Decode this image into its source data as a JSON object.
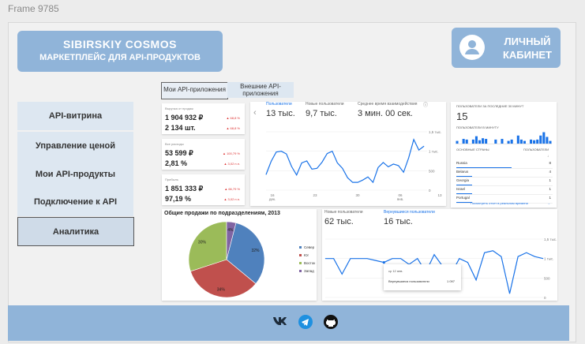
{
  "frame_label": "Frame 9785",
  "brand": {
    "title": "SIBIRSKIY COSMOS",
    "subtitle": "МАРКЕТПЛЕЙС ДЛЯ API-ПРОДУКТОВ"
  },
  "cabinet": {
    "label_line1": "ЛИЧНЫЙ",
    "label_line2": "КАБИНЕТ"
  },
  "sidebar": {
    "items": [
      {
        "label": "API-витрина"
      },
      {
        "label": "Управление ценой"
      },
      {
        "label": "Мои API-продукты"
      },
      {
        "label": "Подключение к API"
      },
      {
        "label": "Аналитика"
      }
    ]
  },
  "tabs": [
    {
      "label": "Мои API-приложения"
    },
    {
      "label": "Внешние API-приложения"
    }
  ],
  "kpi": [
    {
      "label": "Выручка от продаж",
      "v1": "1 904 932 ₽",
      "v2": "2 134 шт.",
      "d1": "▲ 68,8 %",
      "d2": "▲ 68,8 %"
    },
    {
      "label": "Все расходы",
      "v1": "53 599 ₽",
      "v2": "2,81 %",
      "d1": "▲ 100,79 %",
      "d2": "▲ 3,02 п.п."
    },
    {
      "label": "Прибыль",
      "v1": "1 851 333 ₽",
      "v2": "97,19 %",
      "d1": "▲ 66,79 %",
      "d2": "▲ 3,02 п.п."
    }
  ],
  "users_card": {
    "nav_prev": "‹",
    "metrics": [
      {
        "label": "Пользователи",
        "value": "13 тыс."
      },
      {
        "label": "Новые пользователи",
        "value": "9,7 тыс."
      },
      {
        "label": "Среднее время взаимодействия",
        "value": "3 мин. 00 сек."
      }
    ],
    "y_ticks": [
      "1,5 тыс.",
      "1 тыс.",
      "500",
      "0"
    ],
    "x_ticks": [
      "16 дек.",
      "23",
      "30",
      "06 янв.",
      "13"
    ]
  },
  "realtime": {
    "title": "ПОЛЬЗОВАТЕЛИ ЗА ПОСЛЕДНИЕ 30 МИНУТ",
    "value": "15",
    "per_minute": "ПОЛЬЗОВАТЕЛИ В МИНУТУ",
    "bars": [
      0.2,
      0,
      0.35,
      0.3,
      0,
      0.3,
      0.55,
      0.25,
      0.4,
      0.35,
      0,
      0,
      0.3,
      0,
      0.35,
      0,
      0.2,
      0.3,
      0,
      0.6,
      0.3,
      0.2,
      0,
      0.3,
      0.25,
      0.3,
      0.6,
      0.85,
      0.5,
      0.2
    ],
    "col_country": "ОСНОВНЫЕ СТРАНЫ",
    "col_users": "ПОЛЬЗОВАТЕЛИ",
    "countries": [
      {
        "name": "Russia",
        "value": "8"
      },
      {
        "name": "Belarus",
        "value": "4"
      },
      {
        "name": "Georgia",
        "value": "1"
      },
      {
        "name": "Israel",
        "value": "1"
      },
      {
        "name": "Portugal",
        "value": "1"
      }
    ],
    "link": "Посмотреть отчет в реальном времени"
  },
  "pie": {
    "title": "Общие продажи по подразделениям, 2013",
    "legend": [
      {
        "name": "Север",
        "color": "#4f81bd"
      },
      {
        "name": "Юг",
        "color": "#c0504d"
      },
      {
        "name": "Восток",
        "color": "#9bbb59"
      },
      {
        "name": "Запад",
        "color": "#8064a2"
      }
    ]
  },
  "chart_data": [
    {
      "type": "line",
      "title": "",
      "x_ticks": [
        "16 дек.",
        "23",
        "30",
        "06 янв.",
        "13"
      ],
      "ylim": [
        0,
        1500
      ],
      "series": [
        {
          "name": "",
          "values": [
            400,
            740,
            980,
            1000,
            930,
            610,
            390,
            700,
            750,
            540,
            560,
            720,
            940,
            1000,
            700,
            560,
            320,
            200,
            200,
            260,
            340,
            200,
            580,
            710,
            600,
            670,
            630,
            460,
            830,
            1300,
            1030,
            1130
          ]
        }
      ]
    },
    {
      "type": "pie",
      "title": "Общие продажи по подразделениям, 2013",
      "categories": [
        "Север",
        "Юг",
        "Восток",
        "Запад"
      ],
      "values": [
        32,
        34,
        30,
        4
      ]
    },
    {
      "type": "line",
      "ylim": [
        0,
        1500
      ],
      "series": [
        {
          "name": "Новые пользователи",
          "values": [
            1000,
            1000,
            600,
            1000,
            1000,
            1000,
            950,
            900,
            1000,
            1000,
            850,
            1000,
            650,
            1100,
            800,
            600,
            1000,
            900,
            450,
            1150,
            1200,
            1050,
            100,
            1050,
            1150,
            1050,
            1000
          ]
        },
        {
          "name": "Вернувшиеся пользователи",
          "values": [
            1000,
            1000,
            600,
            1000,
            1000,
            1000,
            950,
            900,
            1000,
            1000,
            850,
            1000,
            650,
            1100,
            800,
            600,
            1000,
            900,
            450,
            1150,
            1200,
            1050,
            100,
            1050,
            1150,
            1050,
            1000
          ]
        }
      ]
    },
    {
      "type": "bar",
      "title": "ПОЛЬЗОВАТЕЛИ В МИНУТУ",
      "values": [
        0.2,
        0,
        0.35,
        0.3,
        0,
        0.3,
        0.55,
        0.25,
        0.4,
        0.35,
        0,
        0,
        0.3,
        0,
        0.35,
        0,
        0.2,
        0.3,
        0,
        0.6,
        0.3,
        0.2,
        0,
        0.3,
        0.25,
        0.3,
        0.6,
        0.85,
        0.5,
        0.2
      ]
    }
  ],
  "users2": {
    "labels": [
      {
        "label": "Новые пользователи",
        "value": "62 тыс."
      },
      {
        "label": "Вернувшиеся пользователи",
        "value": "16 тыс."
      }
    ],
    "y_ticks": [
      "1,5 тыс.",
      "1 тыс.",
      "500",
      "0"
    ],
    "tooltip": {
      "title": "ср 12 янв.",
      "label": "Вернувшиеся пользователи",
      "value": "1 097"
    }
  },
  "footer": {
    "icons": [
      "vk-icon",
      "telegram-icon",
      "github-icon"
    ]
  }
}
